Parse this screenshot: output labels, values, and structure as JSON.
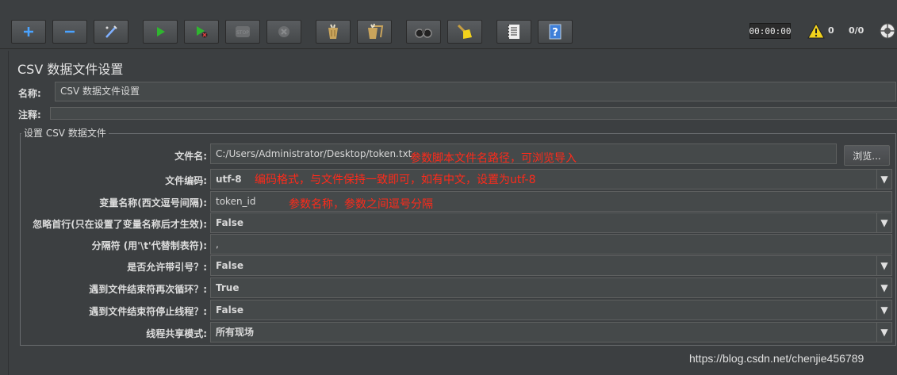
{
  "toolbar": {
    "buttons": [
      {
        "name": "add-icon"
      },
      {
        "name": "remove-icon"
      },
      {
        "name": "wand-icon"
      },
      {
        "name": "start-icon"
      },
      {
        "name": "start-no-pause-icon"
      },
      {
        "name": "stop-icon"
      },
      {
        "name": "shutdown-icon"
      },
      {
        "name": "clear-icon"
      },
      {
        "name": "clear-all-icon"
      },
      {
        "name": "search-binoculars-icon"
      },
      {
        "name": "reset-broom-icon"
      },
      {
        "name": "function-helper-icon"
      },
      {
        "name": "help-icon"
      }
    ],
    "timer": "00:00:00",
    "warning_count": "0",
    "threads": "0/0"
  },
  "panel": {
    "title": "CSV 数据文件设置",
    "name_label": "名称:",
    "name_value": "CSV 数据文件设置",
    "comment_label": "注释:",
    "group_title": "设置 CSV 数据文件"
  },
  "fields": {
    "filename": {
      "label": "文件名:",
      "value": "C:/Users/Administrator/Desktop/token.txt",
      "note": "参数脚本文件名路径，可浏览导入"
    },
    "browse_label": "浏览...",
    "encoding": {
      "label": "文件编码:",
      "value": "utf-8",
      "note": "编码格式，与文件保持一致即可，如有中文，设置为utf-8"
    },
    "varnames": {
      "label": "变量名称(西文逗号间隔):",
      "value": "token_id",
      "note": "参数名称，参数之间逗号分隔"
    },
    "ignore_first": {
      "label": "忽略首行(只在设置了变量名称后才生效):",
      "value": "False"
    },
    "delimiter": {
      "label": "分隔符 (用'\\t'代替制表符):",
      "value": ","
    },
    "allow_quoted": {
      "label": "是否允许带引号？:",
      "value": "False"
    },
    "recycle_eof": {
      "label": "遇到文件结束符再次循环？:",
      "value": "True"
    },
    "stop_eof": {
      "label": "遇到文件结束符停止线程？:",
      "value": "False"
    },
    "sharing": {
      "label": "线程共享模式:",
      "value": "所有现场"
    }
  },
  "watermark": "https://blog.csdn.net/chenjie456789",
  "colors": {
    "background": "#3c3f41",
    "annotation": "#ff2a1a",
    "start_green": "#2fb52f"
  }
}
